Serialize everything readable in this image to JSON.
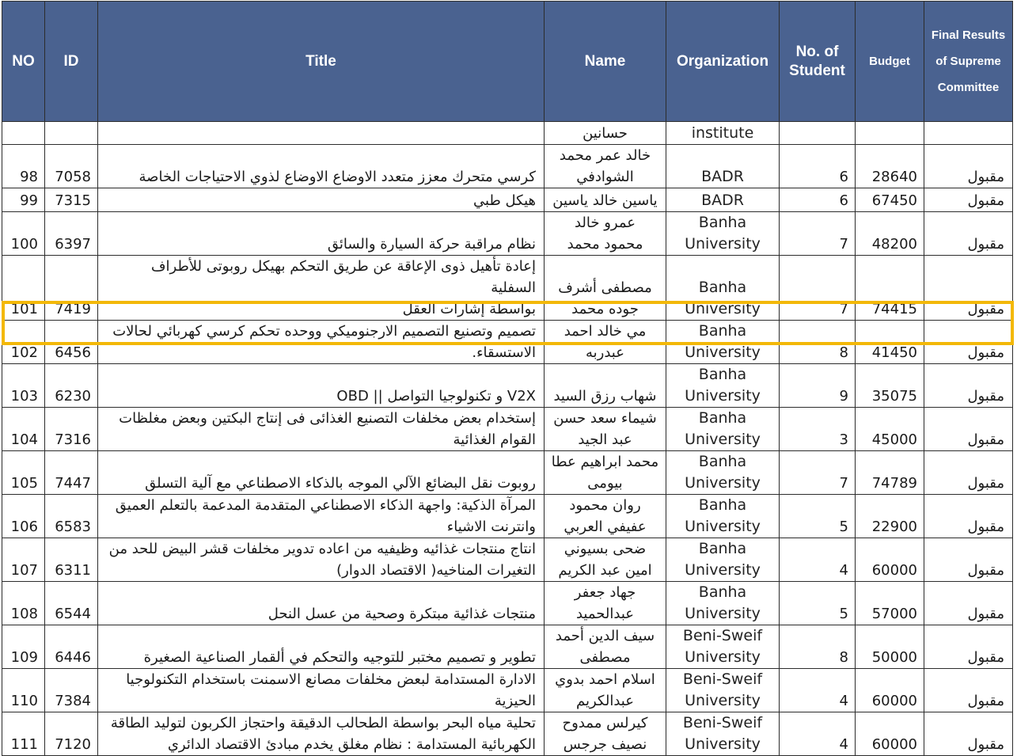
{
  "header": {
    "no": "NO",
    "id": "ID",
    "title": "Title",
    "name": "Name",
    "organization": "Organization",
    "students": "No. of Student",
    "budget": "Budget",
    "final": "Final Results of Supreme Committee"
  },
  "rows": [
    {
      "no": "",
      "id": "",
      "title": "",
      "name": "حسانين",
      "org": "institute",
      "students": "",
      "budget": "",
      "result": ""
    },
    {
      "no": "98",
      "id": "7058",
      "title": "كرسي متحرك معزز متعدد الاوضاع الاوضاع لذوي الاحتياجات الخاصة",
      "name": "خالد عمر محمد\nالشوادفي",
      "org": "BADR",
      "students": "6",
      "budget": "28640",
      "result": "مقبول"
    },
    {
      "no": "99",
      "id": "7315",
      "title": "هيكل طبي",
      "name": "ياسين خالد ياسين",
      "org": "BADR",
      "students": "6",
      "budget": "67450",
      "result": "مقبول"
    },
    {
      "no": "100",
      "id": "6397",
      "title": "نظام مراقبة حركة السيارة والسائق",
      "name": "عمرو خالد\nمحمود محمد",
      "org": "Banha\nUniversity",
      "students": "7",
      "budget": "48200",
      "result": "مقبول"
    },
    {
      "no": "101",
      "id": "7419",
      "title": "إعادة تأهيل ذوى الإعاقة عن طريق التحكم بهيكل روبوتى للأطراف السفلية\nبواسطة إشارات العقل",
      "name": "مصطفى أشرف\nجوده محمد",
      "org": "Banha\nUniversity",
      "students": "7",
      "budget": "74415",
      "result": "مقبول"
    },
    {
      "no": "102",
      "id": "6456",
      "title": "تصميم وتصنيع التصميم الارجنوميكي ووحده تحكم كرسي كهربائي لحالات\nالاستسقاء.",
      "name": "مي خالد احمد\nعبدربه",
      "org": "Banha\nUniversity",
      "students": "8",
      "budget": "41450",
      "result": "مقبول"
    },
    {
      "no": "103",
      "id": "6230",
      "title": "V2X و تكنولوجيا التواصل || OBD",
      "name": "شهاب رزق السيد",
      "org": "Banha\nUniversity",
      "students": "9",
      "budget": "35075",
      "result": "مقبول"
    },
    {
      "no": "104",
      "id": "7316",
      "title": "إستخدام بعض مخلفات التصنيع الغذائى فى إنتاج البكتين وبعض مغلظات\nالقوام الغذائية",
      "name": "شيماء سعد حسن\nعبد الجيد",
      "org": "Banha\nUniversity",
      "students": "3",
      "budget": "45000",
      "result": "مقبول"
    },
    {
      "no": "105",
      "id": "7447",
      "title": "روبوت نقل البضائع الآلي الموجه بالذكاء الاصطناعي مع آلية التسلق",
      "name": "محمد ابراهيم عطا\nبيومى",
      "org": "Banha\nUniversity",
      "students": "7",
      "budget": "74789",
      "result": "مقبول"
    },
    {
      "no": "106",
      "id": "6583",
      "title": "المرآة الذكية: واجهة الذكاء الاصطناعي المتقدمة المدعمة بالتعلم العميق\nوانترنت الاشياء",
      "name": "روان محمود\nعفيفي العربي",
      "org": "Banha\nUniversity",
      "students": "5",
      "budget": "22900",
      "result": "مقبول"
    },
    {
      "no": "107",
      "id": "6311",
      "title": "انتاج منتجات غذائيه وظيفيه من اعاده تدوير مخلفات قشر البيض للحد من\nالتغيرات المناخيه( الاقتصاد الدوار)",
      "name": "ضحى بسيوني\nامين عبد الكريم",
      "org": "Banha\nUniversity",
      "students": "4",
      "budget": "60000",
      "result": "مقبول"
    },
    {
      "no": "108",
      "id": "6544",
      "title": "منتجات غذائية مبتكرة وصحية  من عسل النحل",
      "name": "جهاد جعفر\nعبدالحميد",
      "org": "Banha\nUniversity",
      "students": "5",
      "budget": "57000",
      "result": "مقبول"
    },
    {
      "no": "109",
      "id": "6446",
      "title": "تطوير و تصميم مختبر للتوجيه والتحكم في ألقمار الصناعية الصغيرة",
      "name": "سيف الدين أحمد\nمصطفى",
      "org": "Beni-Sweif\nUniversity",
      "students": "8",
      "budget": "50000",
      "result": "مقبول"
    },
    {
      "no": "110",
      "id": "7384",
      "title": "الادارة المستدامة لبعض مخلفات مصانع الاسمنت باستخدام التكنولوجيا\nالحيزية",
      "name": "اسلام احمد بدوي\nعبدالكريم",
      "org": "Beni-Sweif\nUniversity",
      "students": "4",
      "budget": "60000",
      "result": "مقبول"
    },
    {
      "no": "111",
      "id": "7120",
      "title": "تحلية مياه البحر بواسطة الطحالب الدقيقة واحتجاز الكربون لتوليد الطاقة\nالكهربائية المستدامة : نظام مغلق يخدم مبادئ الاقتصاد الدائري",
      "name": "كيرلس ممدوح\nنصيف جرجس",
      "org": "Beni-Sweif\nUniversity",
      "students": "4",
      "budget": "60000",
      "result": "مقبول"
    }
  ],
  "colors": {
    "header_bg": "#4a6290",
    "highlight": "#f3b807"
  }
}
